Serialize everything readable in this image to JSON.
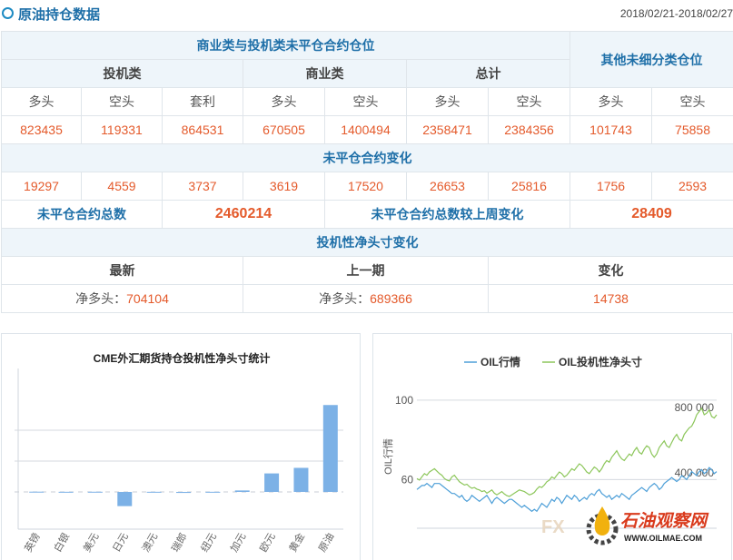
{
  "header": {
    "title": "原油持仓数据",
    "date": "2018/02/21-2018/02/27"
  },
  "table": {
    "section_noncommercial": "商业类与投机类未平仓合约仓位",
    "section_other": "其他未细分类仓位",
    "group_spec": "投机类",
    "group_comm": "商业类",
    "group_total": "总计",
    "col_long": "多头",
    "col_short": "空头",
    "col_spread": "套利",
    "positions": {
      "spec_long": "823435",
      "spec_short": "119331",
      "spec_spread": "864531",
      "comm_long": "670505",
      "comm_short": "1400494",
      "total_long": "2358471",
      "total_short": "2384356",
      "other_long": "101743",
      "other_short": "75858"
    },
    "section_change": "未平仓合约变化",
    "changes": {
      "spec_long": "19297",
      "spec_short": "4559",
      "spec_spread": "3737",
      "comm_long": "3619",
      "comm_short": "17520",
      "total_long": "26653",
      "total_short": "25816",
      "other_long": "1756",
      "other_short": "2593"
    },
    "oi_total_label": "未平仓合约总数",
    "oi_total_value": "2460214",
    "oi_change_label": "未平仓合约总数较上周变化",
    "oi_change_value": "28409",
    "section_net": "投机性净头寸变化",
    "net_col_latest": "最新",
    "net_col_prev": "上一期",
    "net_col_change": "变化",
    "net_latest_label": "净多头：",
    "net_latest_value": "704104",
    "net_prev_label": "净多头：",
    "net_prev_value": "689366",
    "net_change_value": "14738"
  },
  "chart_data": [
    {
      "type": "bar",
      "title": "CME外汇期货持仓投机性净头寸统计",
      "categories": [
        "英镑",
        "白银",
        "美元",
        "日元",
        "澳元",
        "瑞郎",
        "纽元",
        "加元",
        "欧元",
        "黄金",
        "原油"
      ],
      "values": [
        2000,
        1000,
        1500,
        -115000,
        1000,
        -8000,
        1000,
        12000,
        150000,
        195000,
        704104
      ],
      "ylim": [
        -250000,
        1000000
      ],
      "grid": true,
      "bar_color": "#7cb1e6"
    },
    {
      "type": "line",
      "legend_position": "top",
      "series": [
        {
          "name": "OIL行情",
          "color": "#4d9fd8",
          "axis": "left",
          "values": [
            55,
            56,
            57,
            57,
            58,
            57,
            56,
            58,
            58,
            58,
            57,
            56,
            55,
            54,
            53,
            53,
            52,
            51,
            52,
            50,
            49,
            50,
            52,
            51,
            50,
            49,
            50,
            51,
            52,
            50,
            48,
            50,
            51,
            50,
            49,
            48,
            49,
            50,
            50,
            49,
            48,
            47,
            46,
            47,
            46,
            45,
            44,
            45,
            44,
            46,
            48,
            47,
            46,
            48,
            50,
            49,
            51,
            50,
            48,
            50,
            52,
            51,
            50,
            52,
            51,
            49,
            50,
            51,
            50,
            52,
            53,
            52,
            54,
            55,
            53,
            52,
            51,
            52,
            50,
            51,
            52,
            51,
            53,
            52,
            51,
            50,
            52,
            53,
            54,
            55,
            56,
            55,
            54,
            56,
            57,
            58,
            57,
            55,
            56,
            58,
            59,
            60,
            61,
            60,
            59,
            60,
            62,
            61,
            60,
            62,
            64,
            63,
            62,
            64,
            65,
            63,
            64,
            66,
            65,
            63,
            64
          ]
        },
        {
          "name": "OIL投机性净头寸",
          "color": "#8cc65a",
          "axis": "right",
          "values": [
            410,
            400,
            420,
            440,
            430,
            450,
            460,
            470,
            455,
            440,
            430,
            410,
            400,
            395,
            420,
            430,
            410,
            390,
            380,
            370,
            375,
            360,
            350,
            355,
            345,
            340,
            330,
            335,
            320,
            330,
            340,
            320,
            310,
            320,
            330,
            315,
            305,
            300,
            310,
            320,
            330,
            340,
            335,
            330,
            320,
            310,
            315,
            325,
            345,
            360,
            355,
            370,
            390,
            400,
            420,
            410,
            430,
            450,
            440,
            420,
            430,
            450,
            470,
            460,
            480,
            500,
            490,
            470,
            450,
            440,
            460,
            480,
            470,
            450,
            470,
            500,
            520,
            510,
            540,
            560,
            580,
            550,
            530,
            520,
            540,
            560,
            550,
            580,
            600,
            570,
            560,
            590,
            610,
            600,
            560,
            540,
            560,
            600,
            620,
            640,
            610,
            600,
            630,
            660,
            680,
            650,
            640,
            680,
            700,
            720,
            730,
            760,
            800,
            820,
            840,
            800,
            810,
            830,
            790,
            780,
            800
          ]
        }
      ],
      "y_left": {
        "ticks": [
          "100",
          "60"
        ],
        "label": "OIL行情"
      },
      "y_right": {
        "ticks": [
          "800 000",
          "400 000"
        ]
      },
      "ylim_left": [
        35,
        105
      ],
      "ylim_right": [
        100000,
        950000
      ]
    }
  ],
  "watermark": {
    "text_cn": "石油观察网",
    "text_en": "WWW.OILMAE.COM",
    "faded_prefix": "FX"
  }
}
